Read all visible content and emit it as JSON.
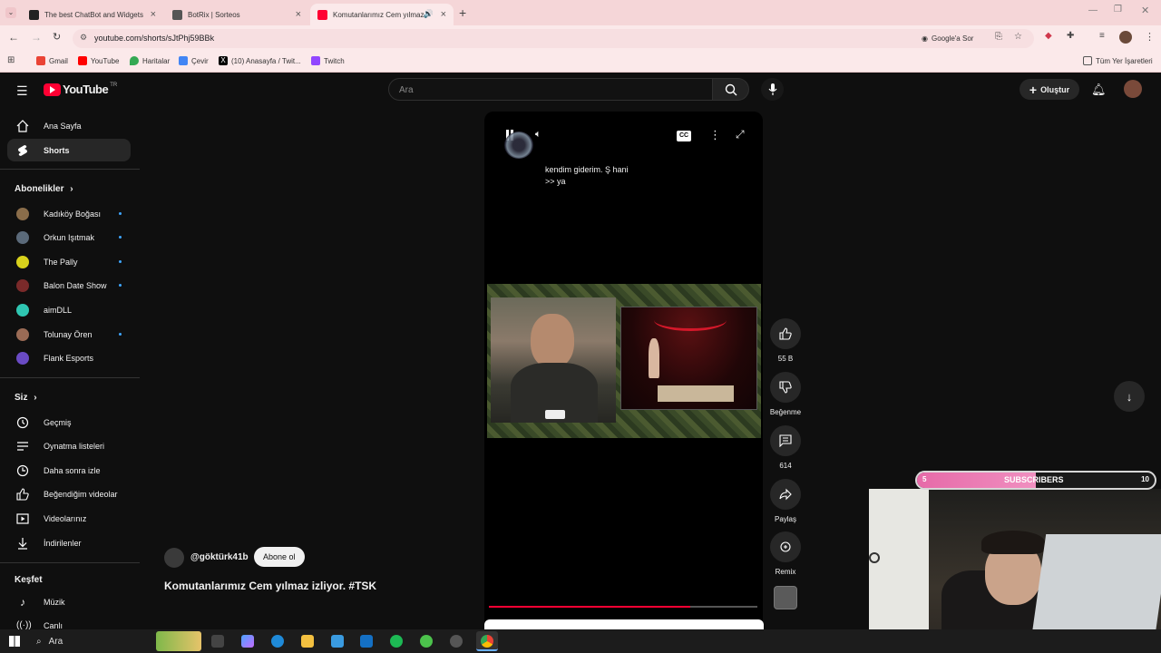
{
  "browser": {
    "tabs": [
      {
        "title": "The best ChatBot and Widgets",
        "active": false
      },
      {
        "title": "BotRix | Sorteos",
        "active": false
      },
      {
        "title": "Komutanlarımız Cem yılmaz",
        "active": true
      }
    ],
    "url": "youtube.com/shorts/sJtPhj59BBk",
    "google_ask": "Google'a Sor",
    "bookmarks": [
      "Gmail",
      "YouTube",
      "Haritalar",
      "Çevir",
      "(10) Anasayfa / Twit...",
      "Twitch"
    ],
    "all_bookmarks": "Tüm Yer İşaretleri"
  },
  "youtube": {
    "logo": "YouTube",
    "region": "TR",
    "search_placeholder": "Ara",
    "create_label": "Oluştur",
    "nav": [
      {
        "label": "Ana Sayfa",
        "icon": "home-icon"
      },
      {
        "label": "Shorts",
        "icon": "shorts-icon"
      }
    ],
    "subscriptions_title": "Abonelikler",
    "subscriptions": [
      {
        "name": "Kadıköy Boğası",
        "color": "#8a6d4a",
        "new": true
      },
      {
        "name": "Orkun Işıtmak",
        "color": "#5b6a7a",
        "new": true
      },
      {
        "name": "The Pally",
        "color": "#d8d21c",
        "new": true
      },
      {
        "name": "Balon Date Show",
        "color": "#7a2a2a",
        "new": true
      },
      {
        "name": "aimDLL",
        "color": "#2fc6b2",
        "new": false
      },
      {
        "name": "Tolunay Ören",
        "color": "#9a6b55",
        "new": true
      },
      {
        "name": "Flank Esports",
        "color": "#6a4bc4",
        "new": false
      }
    ],
    "you_title": "Siz",
    "you_items": [
      {
        "label": "Geçmiş",
        "icon": "history-icon"
      },
      {
        "label": "Oynatma listeleri",
        "icon": "playlist-icon"
      },
      {
        "label": "Daha sonra izle",
        "icon": "watch-later-icon"
      },
      {
        "label": "Beğendiğim videolar",
        "icon": "like-icon"
      },
      {
        "label": "Videolarınız",
        "icon": "your-videos-icon"
      },
      {
        "label": "İndirilenler",
        "icon": "download-icon"
      }
    ],
    "explore_title": "Keşfet",
    "explore_items": [
      {
        "label": "Müzik",
        "icon": "music-icon"
      },
      {
        "label": "Canlı",
        "icon": "live-icon"
      }
    ],
    "short": {
      "caption_line1": "kendim giderim. Ş hani",
      "caption_line2": ">> ya",
      "cc_label": "CC",
      "channel": "@göktürk41b",
      "subscribe_label": "Abone ol",
      "title": "Komutanlarımız Cem yılmaz izliyor. #TSK",
      "progress": 0.75
    },
    "actions": {
      "likes": "55 B",
      "dislike_label": "Beğenme",
      "comments": "614",
      "share_label": "Paylaş",
      "remix_label": "Remix"
    }
  },
  "overlay": {
    "sub_count": "5",
    "sub_label": "SUBSCRIBERS",
    "sub_goal": "10",
    "sub_progress": 0.5
  },
  "taskbar": {
    "search_label": "Ara"
  }
}
